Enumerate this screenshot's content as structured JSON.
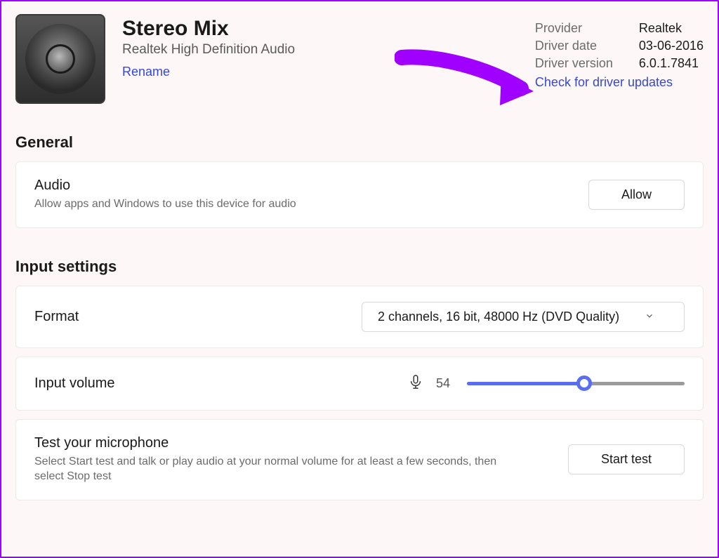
{
  "header": {
    "device_name": "Stereo Mix",
    "device_desc": "Realtek High Definition Audio",
    "rename_link": "Rename"
  },
  "meta": {
    "provider_label": "Provider",
    "provider_value": "Realtek",
    "date_label": "Driver date",
    "date_value": "03-06-2016",
    "version_label": "Driver version",
    "version_value": "6.0.1.7841",
    "check_updates": "Check for driver updates"
  },
  "general": {
    "heading": "General",
    "audio_title": "Audio",
    "audio_desc": "Allow apps and Windows to use this device for audio",
    "allow_btn": "Allow"
  },
  "input": {
    "heading": "Input settings",
    "format_label": "Format",
    "format_value": "2 channels, 16 bit, 48000 Hz (DVD Quality)",
    "volume_label": "Input volume",
    "volume_value": "54",
    "volume_percent": 54,
    "test_title": "Test your microphone",
    "test_desc": "Select Start test and talk or play audio at your normal volume for at least a few seconds, then select Stop test",
    "test_btn": "Start test"
  }
}
